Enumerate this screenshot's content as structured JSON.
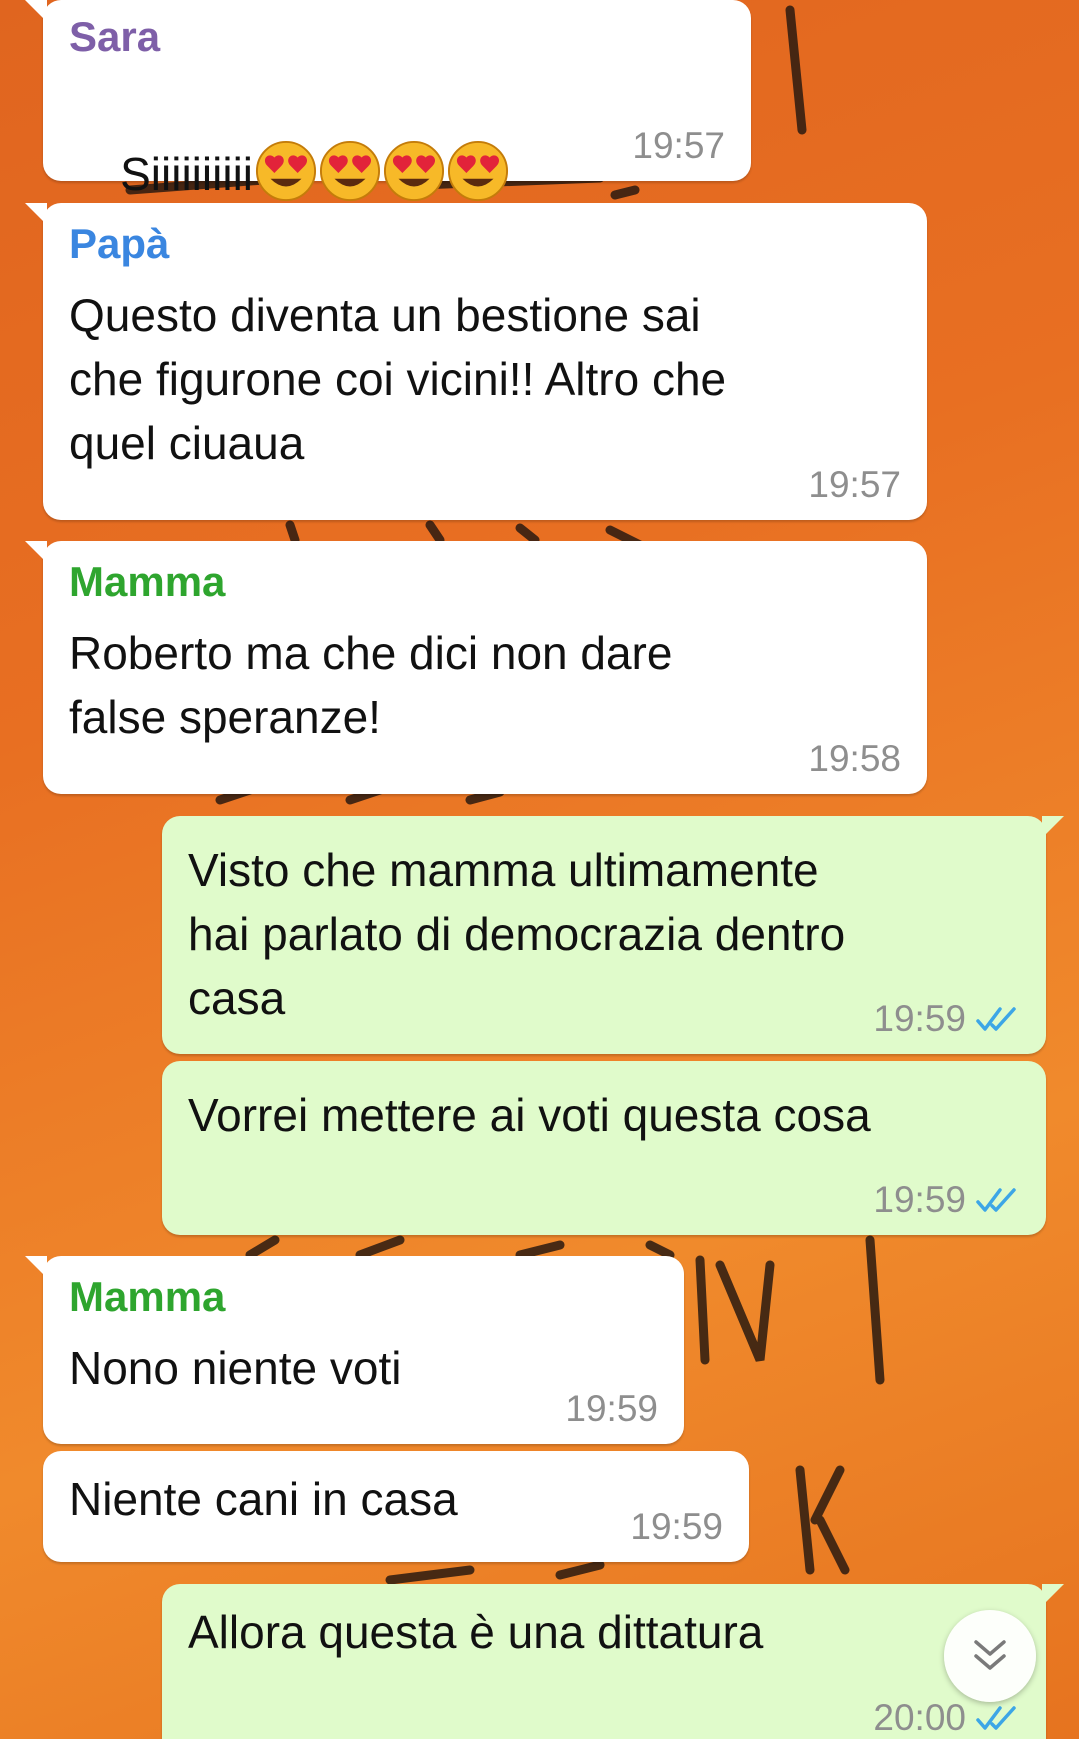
{
  "colors": {
    "wallpaper": "#e86f22",
    "incoming_bubble": "#ffffff",
    "outgoing_bubble": "#e0fbcb",
    "sender_sara": "#7e5fa8",
    "sender_papa": "#3a86e0",
    "sender_mamma": "#2ea52e",
    "read_ticks": "#3da6e6",
    "timestamp": "#8e8e8e"
  },
  "messages": [
    {
      "direction": "in",
      "sender": "Sara",
      "text": "Siiiiiiiiii",
      "emoji": [
        "heart-eyes-emoji",
        "heart-eyes-emoji",
        "heart-eyes-emoji",
        "heart-eyes-emoji"
      ],
      "time": "19:57"
    },
    {
      "direction": "in",
      "sender": "Papà",
      "text": "Questo diventa un bestione sai\nche figurone coi vicini!! Altro che\nquel ciuaua",
      "time": "19:57"
    },
    {
      "direction": "in",
      "sender": "Mamma",
      "text": "Roberto ma che dici non dare\nfalse speranze!",
      "time": "19:58"
    },
    {
      "direction": "out",
      "text": "Visto che mamma ultimamente\nhai parlato di democrazia dentro\ncasa",
      "time": "19:59",
      "status": "read"
    },
    {
      "direction": "out",
      "text": "Vorrei mettere ai voti questa cosa",
      "time": "19:59",
      "status": "read"
    },
    {
      "direction": "in",
      "sender": "Mamma",
      "text": "Nono niente voti",
      "time": "19:59"
    },
    {
      "direction": "in",
      "text": "Niente cani in casa",
      "time": "19:59"
    },
    {
      "direction": "out",
      "text": "Allora questa è una dittatura",
      "time": "20:00",
      "status": "read"
    }
  ],
  "scroll_button_icon": "double-chevron-down-icon"
}
